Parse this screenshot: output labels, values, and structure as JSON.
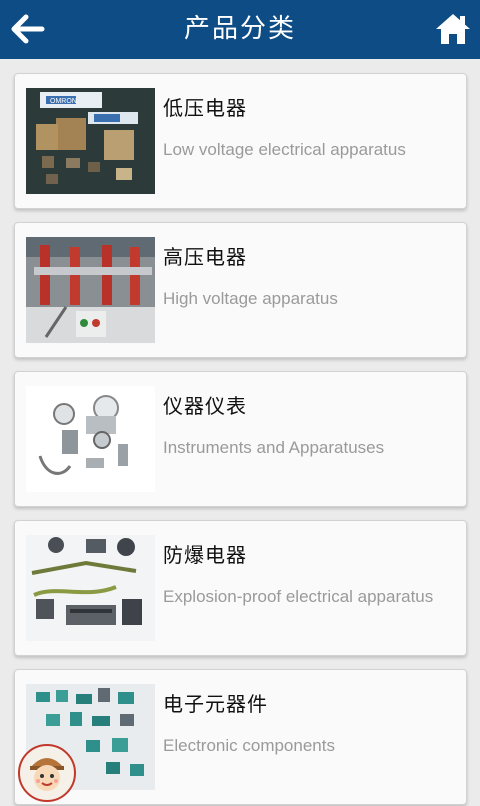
{
  "header": {
    "title": "产品分类",
    "back_icon": "back-arrow-icon",
    "home_icon": "home-icon",
    "bg_color": "#0e4c85"
  },
  "categories": [
    {
      "zh": "低压电器",
      "en": "Low voltage electrical apparatus",
      "image_label": "OMRON"
    },
    {
      "zh": "高压电器",
      "en": "High voltage apparatus"
    },
    {
      "zh": "仪器仪表",
      "en": "Instruments and Apparatuses"
    },
    {
      "zh": "防爆电器",
      "en": "Explosion-proof electrical apparatus"
    },
    {
      "zh": "电子元器件",
      "en": "Electronic components"
    }
  ],
  "floating": {
    "icon": "mascot-avatar-icon"
  }
}
